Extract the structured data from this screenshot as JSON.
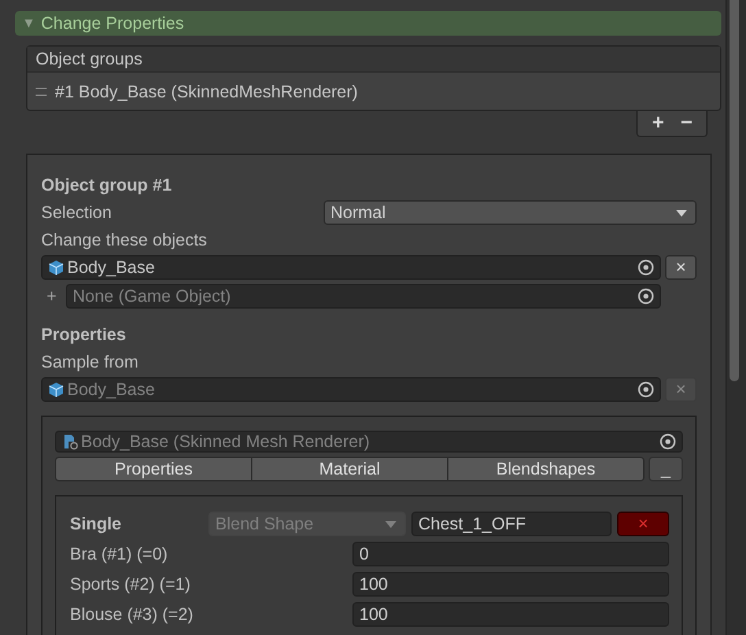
{
  "section": {
    "title": "Change Properties",
    "expanded": true,
    "toggle": "▼"
  },
  "object_groups": {
    "title": "Object groups",
    "items": [
      {
        "label": "#1 Body_Base (SkinnedMeshRenderer)",
        "selected": false
      }
    ],
    "add_button": "+",
    "remove_button": "−"
  },
  "group": {
    "title": "Object group #1",
    "selection_label": "Selection",
    "selection_value": "Normal",
    "change_label": "Change these objects",
    "objects": [
      {
        "kind": "object",
        "value": "Body_Base",
        "remove": "×"
      },
      {
        "kind": "empty",
        "placeholder": "None (Game Object)",
        "add_mark": "+"
      }
    ],
    "properties_title": "Properties",
    "sample_label": "Sample from",
    "sample": {
      "value": "Body_Base",
      "disabled": true,
      "remove": "×"
    },
    "component": {
      "field": "Body_Base (Skinned Mesh Renderer)",
      "disabled": true,
      "buttons": [
        "Properties",
        "Material",
        "Blendshapes"
      ],
      "extra_button": "_"
    },
    "blendshape": {
      "mode": "Single",
      "type_dropdown": {
        "value": "Blend Shape",
        "disabled": true
      },
      "name": "Chest_1_OFF",
      "remove": "×",
      "rows": [
        {
          "label": "Bra (#1) (=0)",
          "value": "0"
        },
        {
          "label": "Sports (#2) (=1)",
          "value": "100"
        },
        {
          "label": "Blouse (#3) (=2)",
          "value": "100"
        }
      ]
    }
  }
}
